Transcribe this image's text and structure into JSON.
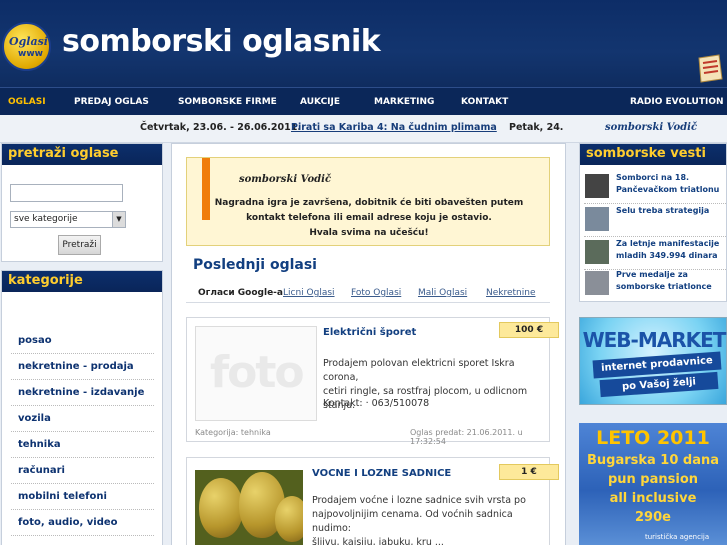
{
  "header": {
    "logo_text": "Oglasi",
    "logo_sub": "www",
    "title": "somborski oglasnik"
  },
  "nav": {
    "items": [
      "OGLASI",
      "PREDAJ OGLAS",
      "SOMBORSKE FIRME",
      "AUKCIJE",
      "MARKETING",
      "KONTAKT",
      "RADIO EVOLUTION"
    ]
  },
  "ticker": {
    "date": "Četvrtak, 23.06. - 26.06.2011.",
    "link": "Pirati sa Kariba 4: Na čudnim plimama",
    "day": "Petak, 24.",
    "brand": "somborski Vodič"
  },
  "search": {
    "title": "pretraži oglase",
    "select_value": "sve kategorije",
    "button": "Pretraži"
  },
  "categories": {
    "title": "kategorije",
    "items": [
      "posao",
      "nekretnine - prodaja",
      "nekretnine - izdavanje",
      "vozila",
      "tehnika",
      "računari",
      "mobilni telefoni",
      "foto, audio, video"
    ]
  },
  "notice": {
    "brand": "somborski Vodič",
    "line1": "Nagradna igra je završena, dobitnik će biti obavešten putem",
    "line2": "kontakt telefona ili email adrese koju je ostavio.",
    "line3": "Hvala svima na učešću!"
  },
  "main": {
    "heading": "Poslednji oglasi",
    "tabs": [
      "Огласи Google-а",
      "Licni Oglasi",
      "Foto Oglasi",
      "Mali Oglasi",
      "Nekretnine"
    ]
  },
  "ads": [
    {
      "title": "Električni šporet",
      "price": "100 €",
      "photo_placeholder": "foto",
      "desc_line1": "Prodajem polovan elektricni sporet Iskra corona,",
      "desc_line2": "cetiri ringle, sa rostfraj plocom, u odlicnom stanju.",
      "contact": "Kontakt:  · 063/510078",
      "category": "Kategorija: tehnika",
      "posted": "Oglas predat: 21.06.2011. u 17:32:54"
    },
    {
      "title": "VOCNE I LOZNE SADNICE",
      "price": "1 €",
      "desc_line1": "Prodajem voćne i lozne sadnice svih vrsta po",
      "desc_line2": "najpovoljnijim cenama. Od voćnih sadnica nudimo:",
      "desc_line3": "šljivu, kajsiju, jabuku, kru ..."
    }
  ],
  "news": {
    "title": "somborske vesti",
    "items": [
      "Somborci na 18. Pančevačkom triatlonu",
      "Selu treba strategija",
      "Za letnje manifestacije mladih 349.994 dinara",
      "Prve medalje za somborske triatlonce"
    ]
  },
  "banners": {
    "web_market": {
      "title": "WEB-MARKET",
      "line1": "internet prodavnice",
      "line2": "po Vašoj želji"
    },
    "leto": {
      "title": "LETO 2011",
      "line1": "Bugarska 10 dana",
      "line2": "pun pansion",
      "line3": "all inclusive",
      "line4": "290e",
      "agency": "turistička agencija"
    }
  }
}
